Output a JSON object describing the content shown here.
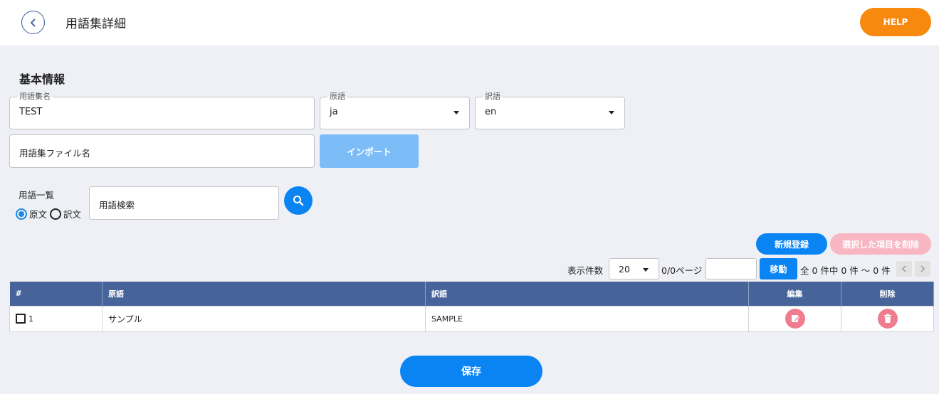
{
  "header": {
    "title": "用語集詳細",
    "help_label": "HELP"
  },
  "basic_info": {
    "section_title": "基本情報",
    "glossary_name": {
      "label": "用語集名",
      "value": "TEST"
    },
    "source_lang": {
      "label": "原語",
      "value": "ja"
    },
    "target_lang": {
      "label": "訳語",
      "value": "en"
    },
    "file_name_placeholder": "用語集ファイル名",
    "import_label": "インポート"
  },
  "term_list": {
    "label": "用語一覧",
    "radio_source": "原文",
    "radio_target": "訳文",
    "search_placeholder": "用語検索"
  },
  "actions": {
    "new_label": "新規登録",
    "delete_selected_label": "選択した項目を削除"
  },
  "pager": {
    "per_page_label": "表示件数",
    "per_page_value": "20",
    "page_info": "0/0ページ",
    "move_label": "移動",
    "total_info": "全 0 件中 0 件 ～ 0 件"
  },
  "table": {
    "headers": {
      "num": "#",
      "source": "原語",
      "target": "訳語",
      "edit": "編集",
      "delete": "削除"
    },
    "rows": [
      {
        "num": "1",
        "source": "サンプル",
        "target": "SAMPLE"
      }
    ]
  },
  "footer": {
    "save_label": "保存"
  },
  "colors": {
    "primary": "#0a84f3",
    "help": "#f7890e",
    "table_header": "#46649a",
    "row_icon": "#ef7d8f"
  }
}
